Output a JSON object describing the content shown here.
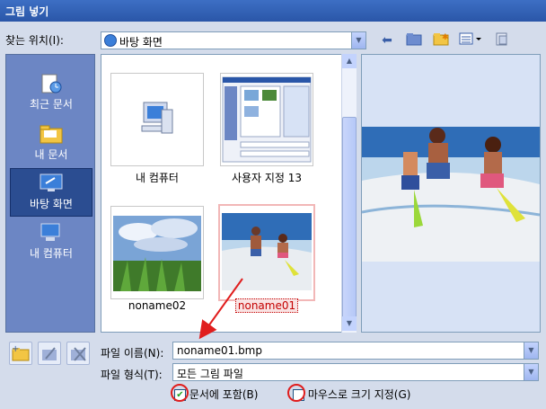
{
  "window": {
    "title": "그림 넣기"
  },
  "look_in": {
    "label": "찾는 위치(I):",
    "value": "바탕 화면"
  },
  "places": [
    {
      "label": "최근 문서",
      "selected": false
    },
    {
      "label": "내 문서",
      "selected": false
    },
    {
      "label": "바탕 화면",
      "selected": true
    },
    {
      "label": "내 컴퓨터",
      "selected": false
    }
  ],
  "files": [
    {
      "name": "내 컴퓨터"
    },
    {
      "name": "사용자 지정 13"
    },
    {
      "name": "noname02"
    },
    {
      "name": "noname01",
      "selected": true
    }
  ],
  "filename": {
    "label": "파일 이름(N):",
    "value": "noname01.bmp"
  },
  "filetype": {
    "label": "파일 형식(T):",
    "value": "모든 그림 파일"
  },
  "options": {
    "include_in_doc": {
      "label": "문서에 포함(B)",
      "checked": true
    },
    "mouse_size": {
      "label": "마우스로 크기 지정(G)",
      "checked": false
    }
  },
  "colors": {
    "title_bar": "#2a56a8",
    "places_bg": "#6c86c4",
    "annotation": "#e01d1d"
  }
}
